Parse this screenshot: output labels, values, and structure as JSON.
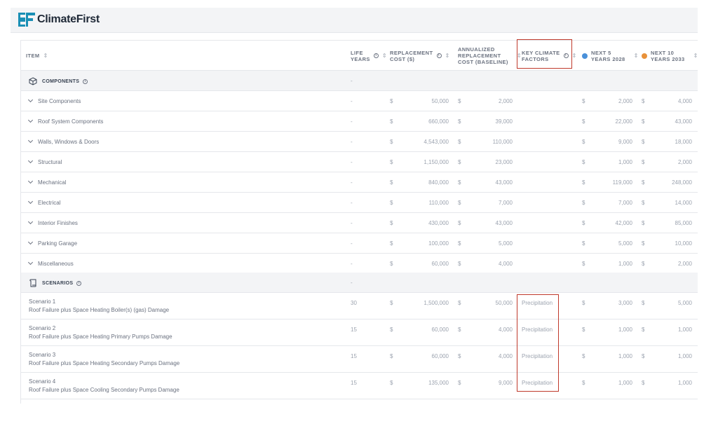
{
  "app": {
    "brand": "ClimateFirst"
  },
  "table": {
    "headers": {
      "item": "ITEM",
      "life_years": "LIFE\nYEARS",
      "replacement_cost": "REPLACEMENT\nCOST ($)",
      "annualized": "ANNUALIZED\nREPLACEMENT\nCOST (BASELINE)",
      "key_climate": "KEY CLIMATE\nFACTORS",
      "next5": "NEXT 5\nYEARS 2028",
      "next10": "NEXT 10\nYEARS 2033"
    },
    "series_colors": {
      "next5": "#4a90d9",
      "next10": "#e8913a"
    },
    "currency": "$",
    "components": {
      "label": "COMPONENTS",
      "dash": "-",
      "rows": [
        {
          "name": "Site Components",
          "life": "-",
          "replacement": "50,000",
          "annualized": "2,000",
          "climate": "",
          "next5": "2,000",
          "next10": "4,000"
        },
        {
          "name": "Roof System Components",
          "life": "-",
          "replacement": "660,000",
          "annualized": "39,000",
          "climate": "",
          "next5": "22,000",
          "next10": "43,000"
        },
        {
          "name": "Walls, Windows & Doors",
          "life": "-",
          "replacement": "4,543,000",
          "annualized": "110,000",
          "climate": "",
          "next5": "9,000",
          "next10": "18,000"
        },
        {
          "name": "Structural",
          "life": "-",
          "replacement": "1,150,000",
          "annualized": "23,000",
          "climate": "",
          "next5": "1,000",
          "next10": "2,000"
        },
        {
          "name": "Mechanical",
          "life": "-",
          "replacement": "840,000",
          "annualized": "43,000",
          "climate": "",
          "next5": "119,000",
          "next10": "248,000"
        },
        {
          "name": "Electrical",
          "life": "-",
          "replacement": "110,000",
          "annualized": "7,000",
          "climate": "",
          "next5": "7,000",
          "next10": "14,000"
        },
        {
          "name": "Interior Finishes",
          "life": "-",
          "replacement": "430,000",
          "annualized": "43,000",
          "climate": "",
          "next5": "42,000",
          "next10": "85,000"
        },
        {
          "name": "Parking Garage",
          "life": "-",
          "replacement": "100,000",
          "annualized": "5,000",
          "climate": "",
          "next5": "5,000",
          "next10": "10,000"
        },
        {
          "name": "Miscellaneous",
          "life": "-",
          "replacement": "60,000",
          "annualized": "4,000",
          "climate": "",
          "next5": "1,000",
          "next10": "2,000"
        }
      ]
    },
    "scenarios": {
      "label": "SCENARIOS",
      "dash": "-",
      "rows": [
        {
          "title": "Scenario 1",
          "desc": "Roof Failure plus Space Heating Boiler(s) (gas) Damage",
          "life": "30",
          "replacement": "1,500,000",
          "annualized": "50,000",
          "climate": "Precipitation",
          "next5": "3,000",
          "next10": "5,000"
        },
        {
          "title": "Scenario 2",
          "desc": "Roof Failure plus Space Heating Primary Pumps Damage",
          "life": "15",
          "replacement": "60,000",
          "annualized": "4,000",
          "climate": "Precipitation",
          "next5": "1,000",
          "next10": "1,000"
        },
        {
          "title": "Scenario 3",
          "desc": "Roof Failure plus Space Heating Secondary Pumps Damage",
          "life": "15",
          "replacement": "60,000",
          "annualized": "4,000",
          "climate": "Precipitation",
          "next5": "1,000",
          "next10": "1,000"
        },
        {
          "title": "Scenario 4",
          "desc": "Roof Failure plus Space Cooling Secondary Pumps Damage",
          "life": "15",
          "replacement": "135,000",
          "annualized": "9,000",
          "climate": "Precipitation",
          "next5": "1,000",
          "next10": "1,000"
        }
      ]
    }
  }
}
